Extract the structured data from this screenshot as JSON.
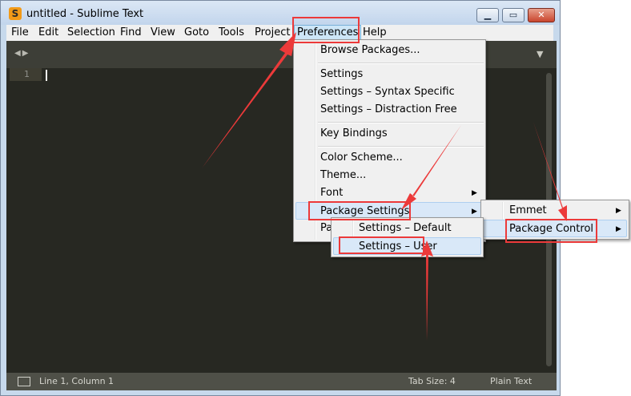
{
  "window": {
    "title": "untitled - Sublime Text"
  },
  "menubar": {
    "items": [
      "File",
      "Edit",
      "Selection",
      "Find",
      "View",
      "Goto",
      "Tools",
      "Project",
      "Preferences",
      "Help"
    ],
    "active": "Preferences"
  },
  "editor": {
    "line_number": "1"
  },
  "statusbar": {
    "position": "Line 1, Column 1",
    "tab_size": "Tab Size: 4",
    "syntax": "Plain Text"
  },
  "preferences_menu": {
    "browse_packages": "Browse Packages...",
    "settings": "Settings",
    "settings_syntax": "Settings – Syntax Specific",
    "settings_distraction": "Settings – Distraction Free",
    "key_bindings": "Key Bindings",
    "color_scheme": "Color Scheme...",
    "theme": "Theme...",
    "font": "Font",
    "package_settings": "Package Settings",
    "partial_item": "Pa"
  },
  "package_settings_menu": {
    "emmet": "Emmet",
    "package_control": "Package Control"
  },
  "package_control_menu": {
    "settings_default": "Settings – Default",
    "settings_user": "Settings – User"
  },
  "icons": {
    "app": "sublime-text-icon",
    "minimize": "minimize-icon",
    "maximize": "maximize-icon",
    "close": "close-icon"
  },
  "colors": {
    "annotation": "#ec3a3a",
    "editor_bg": "#272822",
    "menu_bg": "#f0f0f0",
    "highlight": "#d9e8f8"
  }
}
